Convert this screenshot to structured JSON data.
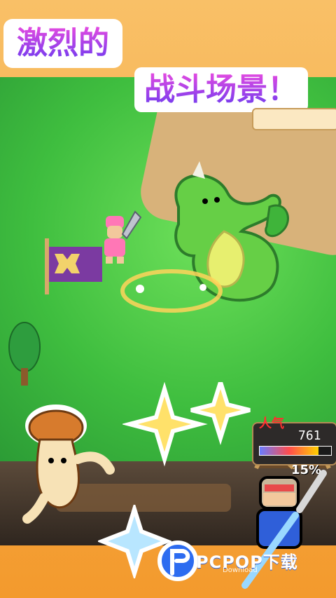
{
  "title": {
    "line1": "激烈的",
    "line2": "战斗场景！"
  },
  "hud": {
    "top_label": "",
    "popularity_label": "人气",
    "popularity_value": "761",
    "popularity_fill_fraction": 0.82,
    "percent": "15%"
  },
  "watermark": {
    "brand": "PCPOP下载",
    "sub": "Download"
  },
  "colors": {
    "title_gradient_start": "#e84be0",
    "title_gradient_end": "#6b3bf0",
    "grass": "#3fbe3f",
    "path": "#d8b27a",
    "orange_bg": "#f39a2d"
  },
  "icons": {
    "dragon": "green-dragon-sprite",
    "hero": "hero-with-sword-sprite",
    "flag": "purple-guild-flag-sprite",
    "tree": "pine-tree-sprite",
    "mushroom": "mushroom-character-sprite",
    "knight": "knight-character-sprite",
    "sparkles": "gold-sparkle-burst"
  }
}
